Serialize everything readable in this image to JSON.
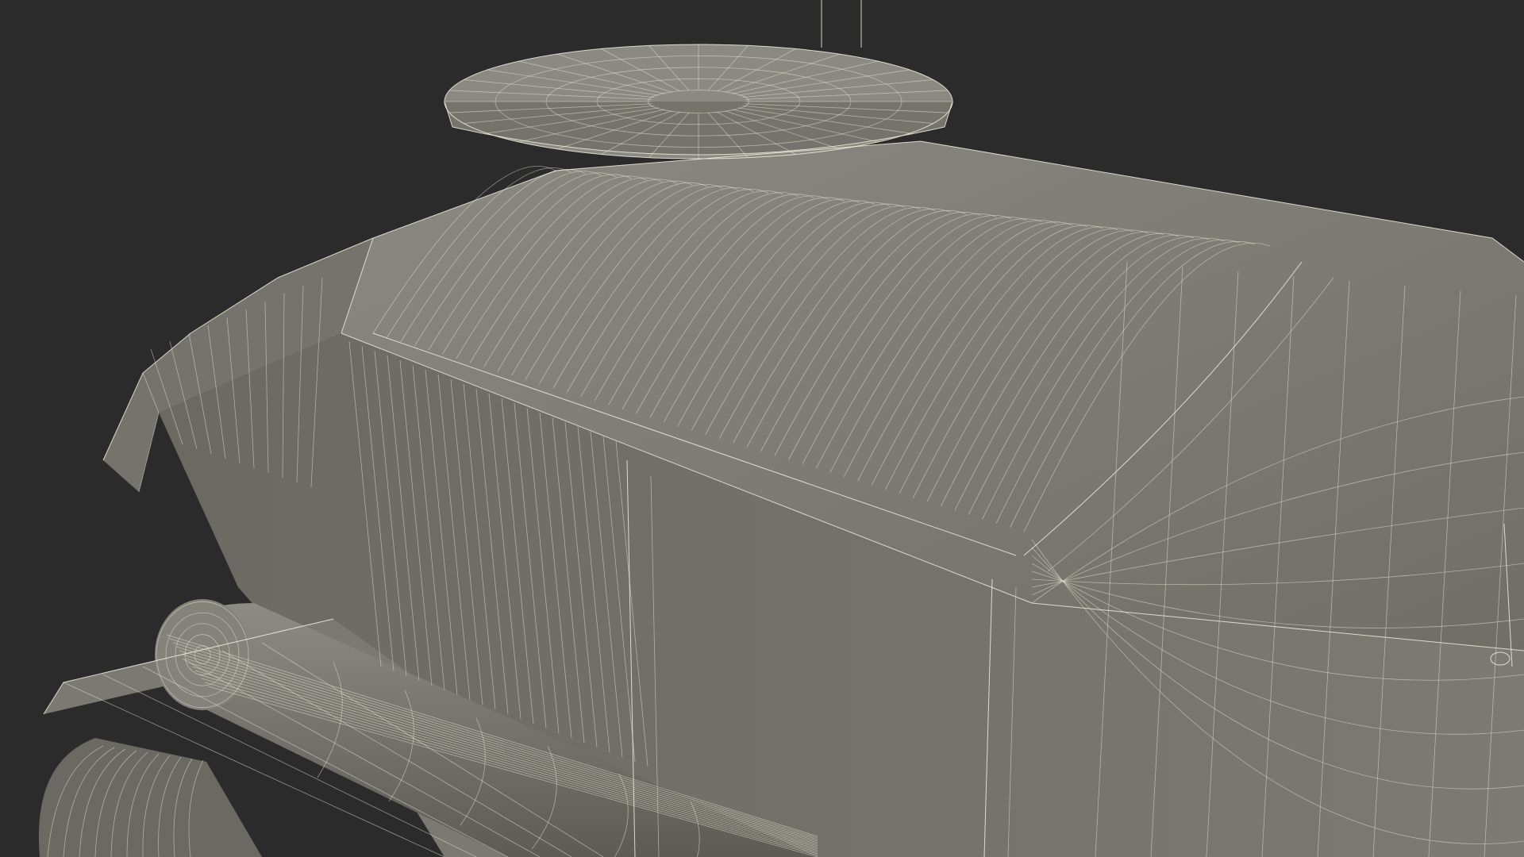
{
  "scene": {
    "subject": "",
    "background_color": "#2b2b2b",
    "surface_color": "#7b7b72",
    "wire_color": "#eeeedd"
  }
}
